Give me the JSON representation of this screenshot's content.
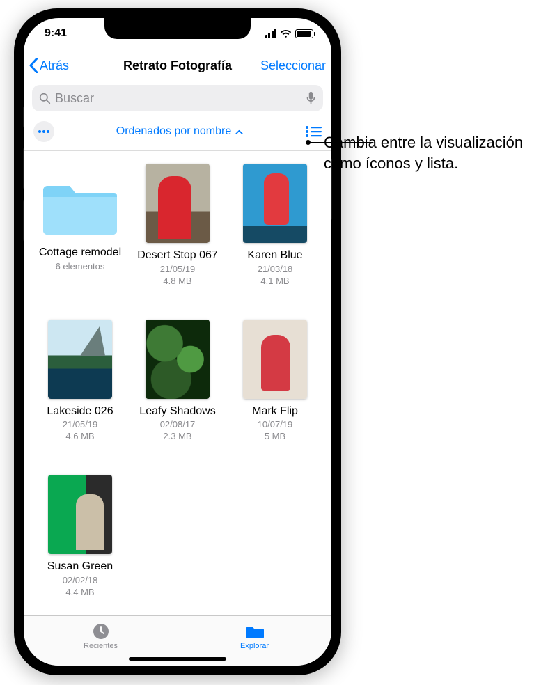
{
  "status": {
    "time": "9:41"
  },
  "nav": {
    "back_label": "Atrás",
    "title": "Retrato Fotografía",
    "select_label": "Seleccionar"
  },
  "search": {
    "placeholder": "Buscar"
  },
  "sortbar": {
    "label": "Ordenados por nombre"
  },
  "items": [
    {
      "name": "Cottage remodel",
      "sub1": "6 elementos",
      "sub2": "",
      "kind": "folder"
    },
    {
      "name": "Desert Stop 067",
      "sub1": "21/05/19",
      "sub2": "4.8 MB",
      "kind": "img",
      "art": "th-desert"
    },
    {
      "name": "Karen Blue",
      "sub1": "21/03/18",
      "sub2": "4.1 MB",
      "kind": "img",
      "art": "th-blue"
    },
    {
      "name": "Lakeside 026",
      "sub1": "21/05/19",
      "sub2": "4.6 MB",
      "kind": "img",
      "art": "th-lake"
    },
    {
      "name": "Leafy Shadows",
      "sub1": "02/08/17",
      "sub2": "2.3 MB",
      "kind": "img",
      "art": "th-leafy"
    },
    {
      "name": "Mark Flip",
      "sub1": "10/07/19",
      "sub2": "5 MB",
      "kind": "img",
      "art": "th-flip"
    },
    {
      "name": "Susan Green",
      "sub1": "02/02/18",
      "sub2": "4.4 MB",
      "kind": "img",
      "art": "th-susan"
    }
  ],
  "tabs": {
    "recents": "Recientes",
    "browse": "Explorar"
  },
  "callout": "Cambia entre la visualización como íconos y lista."
}
